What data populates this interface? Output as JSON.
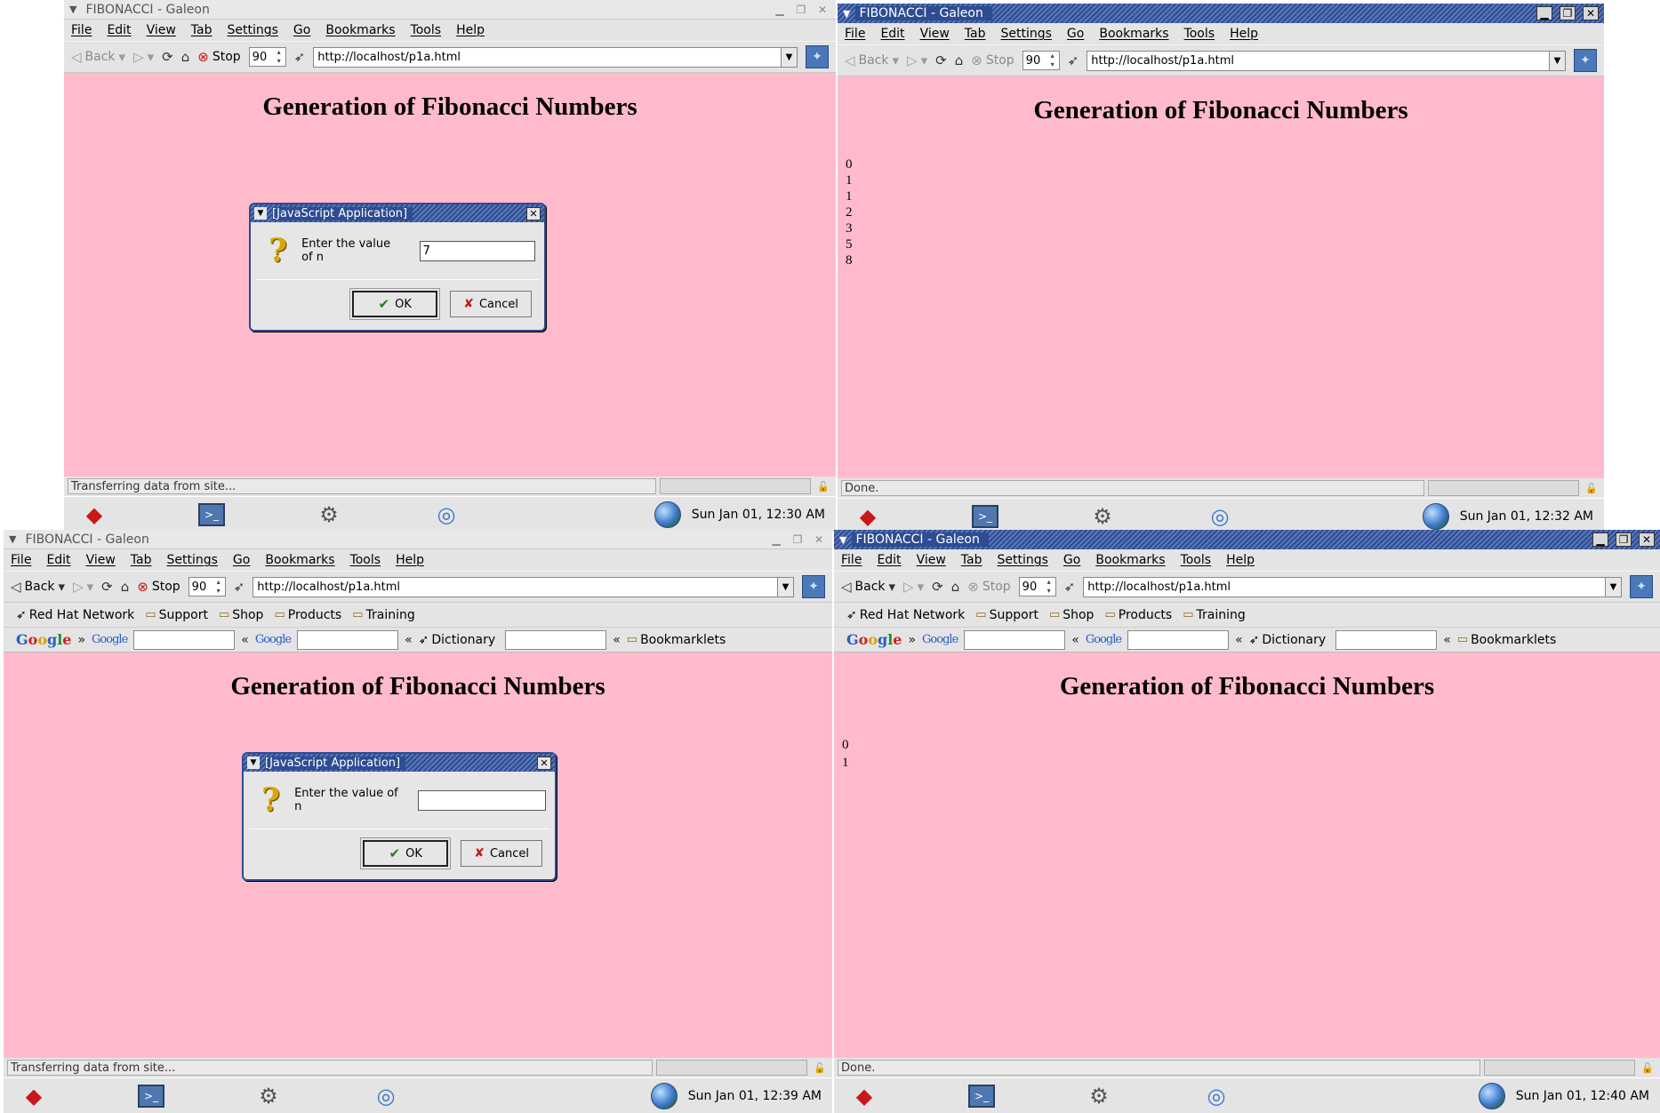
{
  "app": {
    "window_title": "FIBONACCI - Galeon",
    "menus": [
      "File",
      "Edit",
      "View",
      "Tab",
      "Settings",
      "Go",
      "Bookmarks",
      "Tools",
      "Help"
    ],
    "toolbar": {
      "back": "Back",
      "stop": "Stop",
      "zoom": "90",
      "url": "http://localhost/p1a.html"
    },
    "bookmarks": [
      "Red Hat Network",
      "Support",
      "Shop",
      "Products",
      "Training"
    ],
    "search_bar": {
      "google": "Google",
      "groups": "Google",
      "images": "Google",
      "dictionary": "Dictionary",
      "bookmarklets": "Bookmarklets"
    },
    "page_heading": "Generation of Fibonacci Numbers"
  },
  "dialog": {
    "title": "[JavaScript Application]",
    "prompt": "Enter the value of n",
    "ok": "OK",
    "cancel": "Cancel"
  },
  "screens": [
    {
      "status": "Transferring data from site...",
      "clock": "Sun Jan 01, 12:30 AM",
      "dialog_value": "7"
    },
    {
      "status": "Done.",
      "clock": "Sun Jan 01, 12:32 AM",
      "output": [
        "0",
        "1",
        "1",
        "2",
        "3",
        "5",
        "8"
      ]
    },
    {
      "status": "Transferring data from site...",
      "clock": "Sun Jan 01, 12:39 AM",
      "dialog_value": ""
    },
    {
      "status": "Done.",
      "clock": "Sun Jan 01, 12:40 AM",
      "output": [
        "0",
        "1"
      ]
    }
  ],
  "icons": {
    "back": "left-triangle",
    "forward": "right-triangle",
    "reload": "refresh",
    "home": "house",
    "stop": "stop-circle",
    "folder": "folder",
    "question": "question-mark",
    "redhat": "red-hat",
    "terminal": "terminal",
    "globe": "globe"
  },
  "colors": {
    "page_background": "#ffbbcc",
    "title_active": "#2e4c92",
    "redhat": "#c81818"
  }
}
